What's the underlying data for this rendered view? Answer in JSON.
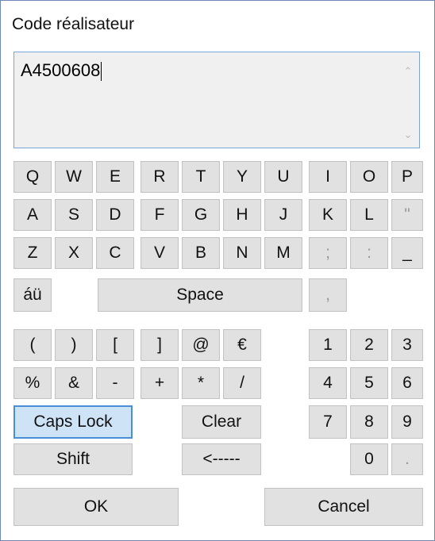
{
  "dialog": {
    "title": "Code réalisateur",
    "input_value": "A4500608"
  },
  "keys": {
    "row1_left": [
      "Q",
      "W",
      "E",
      "R",
      "T",
      "Y",
      "U"
    ],
    "row1_right": [
      "I",
      "O",
      "P"
    ],
    "row2_left": [
      "A",
      "S",
      "D",
      "F",
      "G",
      "H",
      "J"
    ],
    "row2_right": [
      "K",
      "L",
      "\""
    ],
    "row3_left": [
      "Z",
      "X",
      "C",
      "V",
      "B",
      "N",
      "M"
    ],
    "row3_right": [
      ";",
      ":",
      "_"
    ],
    "accents": "áü",
    "space": "Space",
    "comma": ",",
    "sym_row1": [
      "(",
      ")",
      "[",
      "]",
      "@",
      "€"
    ],
    "sym_row2": [
      "%",
      "&",
      "-",
      "+",
      "*",
      "/"
    ],
    "num_row1": [
      "1",
      "2",
      "3"
    ],
    "num_row2": [
      "4",
      "5",
      "6"
    ],
    "num_row3": [
      "7",
      "8",
      "9"
    ],
    "num_row4": [
      "0",
      "."
    ],
    "caps_lock": "Caps Lock",
    "clear": "Clear",
    "shift": "Shift",
    "backspace": "<-----",
    "ok": "OK",
    "cancel": "Cancel"
  },
  "colors": {
    "active_key_bg": "#cfe3f7",
    "active_key_border": "#4a8ed8",
    "textbox_border": "#7aa6d6"
  }
}
